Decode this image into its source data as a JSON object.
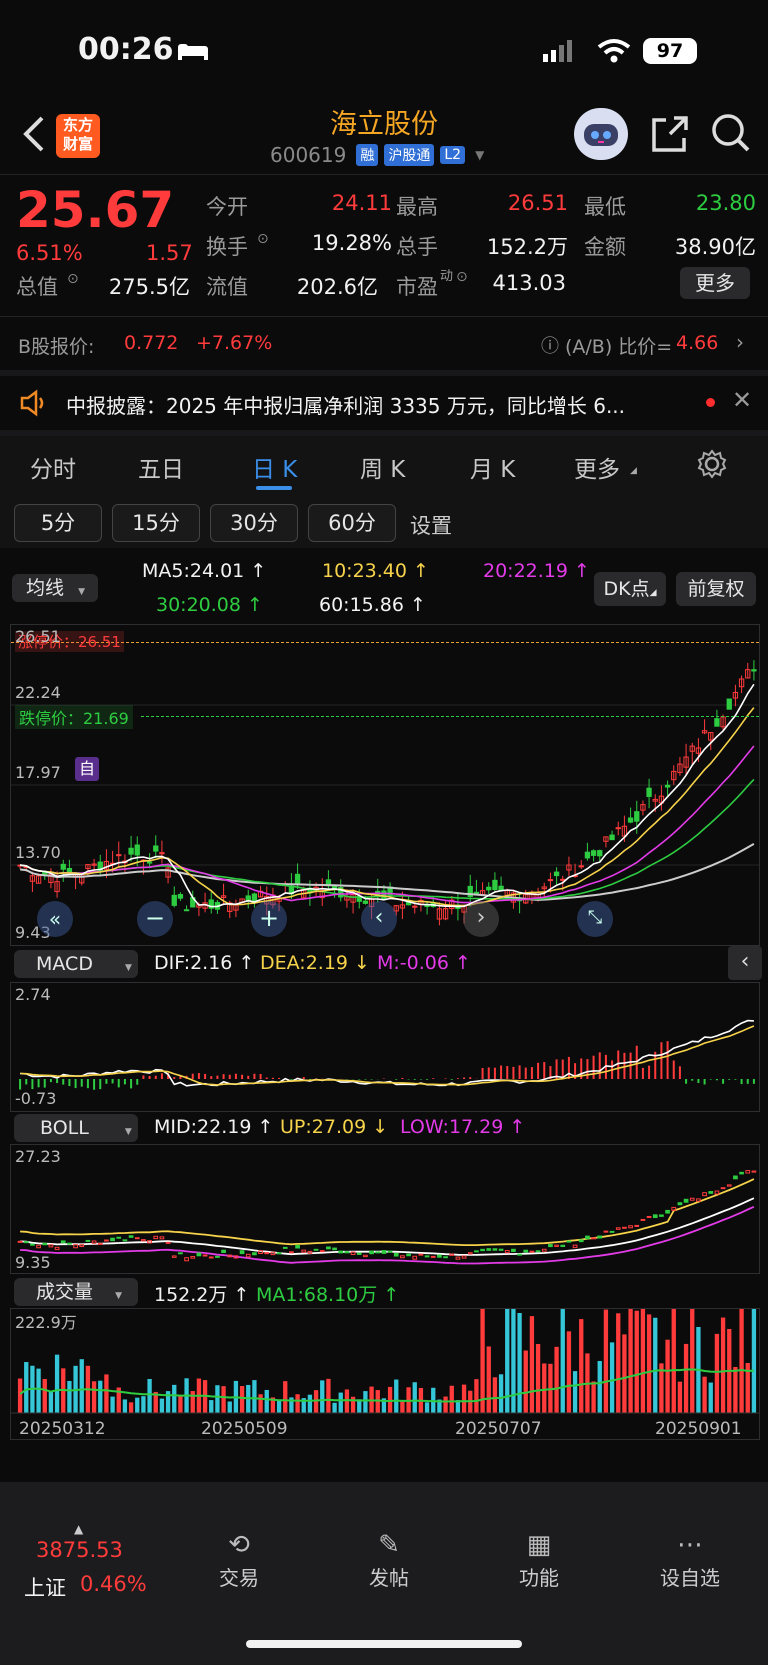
{
  "status_bar": {
    "time": "00:26",
    "battery": "97"
  },
  "header": {
    "brand": "东方财富",
    "brand_line1": "东方",
    "brand_line2": "财富",
    "stock_name": "海立股份",
    "stock_code": "600619",
    "badges": [
      "融",
      "沪股通",
      "L2"
    ]
  },
  "quote": {
    "price": "25.67",
    "change_pct": "6.51%",
    "change": "1.57",
    "open_label": "今开",
    "open": "24.11",
    "high_label": "最高",
    "high": "26.51",
    "low_label": "最低",
    "low": "23.80",
    "turnover_label": "换手",
    "turnover": "19.28%",
    "volume_label": "总手",
    "volume": "152.2万",
    "amount_label": "金额",
    "amount": "38.90亿",
    "mktcap_label": "总值",
    "mktcap": "275.5亿",
    "float_label": "流值",
    "float": "202.6亿",
    "pe_label": "市盈",
    "pe_sup": "动",
    "pe": "413.03",
    "more_label": "更多"
  },
  "bshare": {
    "label": "B股报价:",
    "price": "0.772",
    "change": "+7.67%",
    "ratio_label": "(A/B) 比价=",
    "ratio": "4.66"
  },
  "notice": {
    "text": "中报披露：2025 年中报归属净利润 3335 万元，同比增长 6..."
  },
  "tabs": {
    "items": [
      "分时",
      "五日",
      "日 K",
      "周 K",
      "月 K",
      "更多"
    ],
    "active": 2
  },
  "periods": {
    "items": [
      "5分",
      "15分",
      "30分",
      "60分"
    ],
    "settings": "设置"
  },
  "ma_bar": {
    "selector": "均线",
    "ma5": "MA5:24.01",
    "ma10": "10:23.40",
    "ma20": "20:22.19",
    "ma30": "30:20.08",
    "ma60": "60:15.86",
    "dk_label": "DK点",
    "adjust_label": "前复权"
  },
  "kline": {
    "y_labels": [
      "26.51",
      "22.24",
      "17.97",
      "13.70",
      "9.43"
    ],
    "limit_up_label": "涨停价：26.51",
    "limit_down_label": "跌停价：21.69",
    "self_marker": "自"
  },
  "macd": {
    "selector": "MACD",
    "dif": "DIF:2.16",
    "dea": "DEA:2.19",
    "m": "M:-0.06",
    "y_top": "2.74",
    "y_bottom": "-0.73"
  },
  "boll": {
    "selector": "BOLL",
    "mid": "MID:22.19",
    "up": "UP:27.09",
    "low": "LOW:17.29",
    "y_top": "27.23",
    "y_bottom": "9.35"
  },
  "vol": {
    "selector": "成交量",
    "value": "152.2万",
    "ma1": "MA1:68.10万",
    "y_top": "222.9万",
    "dates": [
      "20250312",
      "20250509",
      "20250707",
      "20250901"
    ]
  },
  "bottom_nav": {
    "index_value": "3875.53",
    "index_name": "上证",
    "index_change": "0.46%",
    "items": [
      "交易",
      "发帖",
      "功能",
      "设自选"
    ]
  },
  "colors": {
    "up": "#ff3b3b",
    "down": "#2ecc40",
    "accent": "#3b8fe8",
    "ma5": "#ffffff",
    "ma10": "#f6d34a",
    "ma20": "#e33be8",
    "ma30": "#2ecc40",
    "ma60": "#cccccc"
  }
}
